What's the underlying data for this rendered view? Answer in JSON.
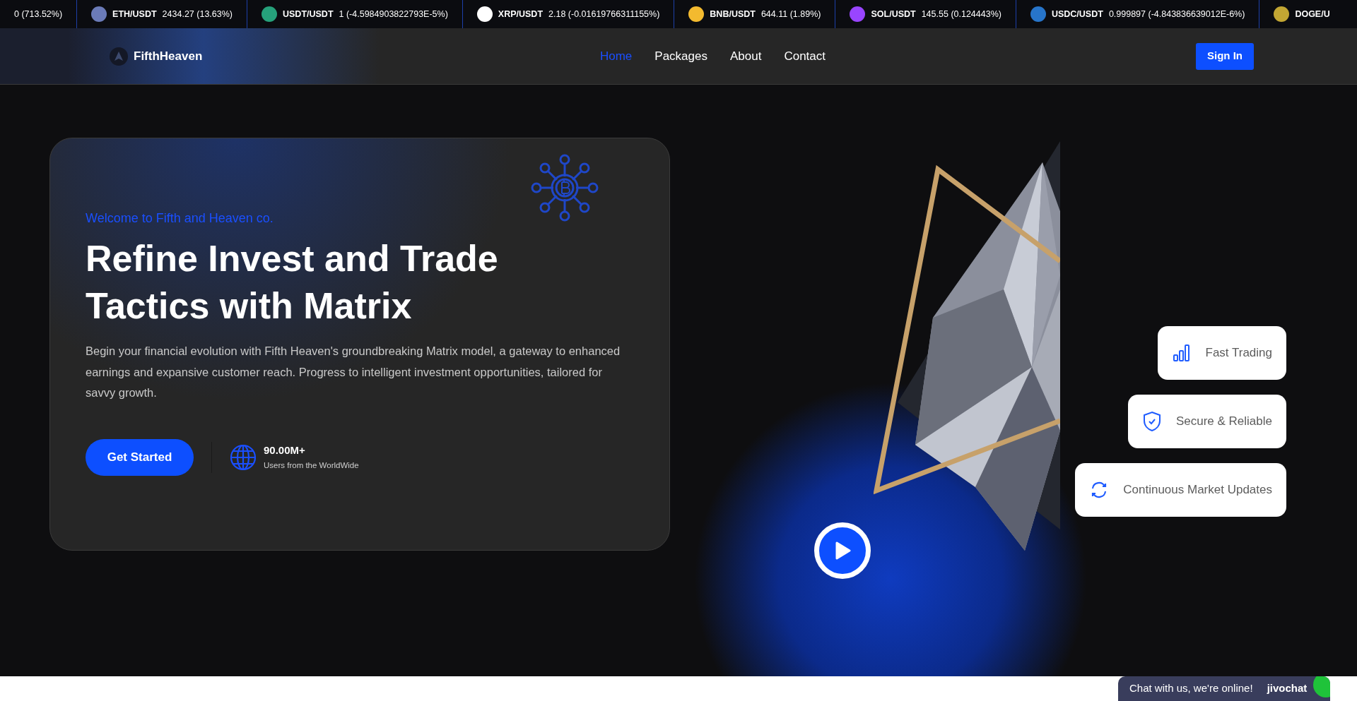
{
  "ticker": [
    {
      "value": "0 (713.52%)"
    },
    {
      "pair": "ETH/USDT",
      "value": "2434.27 (13.63%)",
      "color": "#6b7bb8"
    },
    {
      "pair": "USDT/USDT",
      "value": "1 (-4.5984903822793E-5%)",
      "color": "#26a17b"
    },
    {
      "pair": "XRP/USDT",
      "value": "2.18 (-0.01619766311155%)",
      "color": "#ffffff"
    },
    {
      "pair": "BNB/USDT",
      "value": "644.11 (1.89%)",
      "color": "#f3ba2f"
    },
    {
      "pair": "SOL/USDT",
      "value": "145.55 (0.124443%)",
      "color": "#9945ff"
    },
    {
      "pair": "USDC/USDT",
      "value": "0.999897 (-4.843836639012E-6%)",
      "color": "#2775ca"
    },
    {
      "pair": "DOGE/U",
      "color": "#c2a633"
    }
  ],
  "nav": {
    "brand": "FifthHeaven",
    "links": [
      {
        "label": "Home",
        "selected": true
      },
      {
        "label": "Packages",
        "selected": false
      },
      {
        "label": "About",
        "selected": false
      },
      {
        "label": "Contact",
        "selected": false
      }
    ],
    "sign_in": "Sign In"
  },
  "hero": {
    "eyebrow": "Welcome to Fifth and Heaven co.",
    "title": "Refine Invest and Trade Tactics with Matrix",
    "text": "Begin your financial evolution with Fifth Heaven's groundbreaking Matrix model, a gateway to enhanced earnings and expansive customer reach. Progress to intelligent investment opportunities, tailored for savvy growth.",
    "cta": "Get Started",
    "stat_value": "90.00M+",
    "stat_label": "Users from the WorldWide"
  },
  "features": [
    {
      "kind": "bars",
      "label": "Fast Trading"
    },
    {
      "kind": "shield",
      "label": "Secure & Reliable"
    },
    {
      "kind": "sync",
      "label": "Continuous Market Updates"
    }
  ],
  "chat": {
    "text": "Chat with us, we're online!",
    "brand": "jivochat"
  }
}
